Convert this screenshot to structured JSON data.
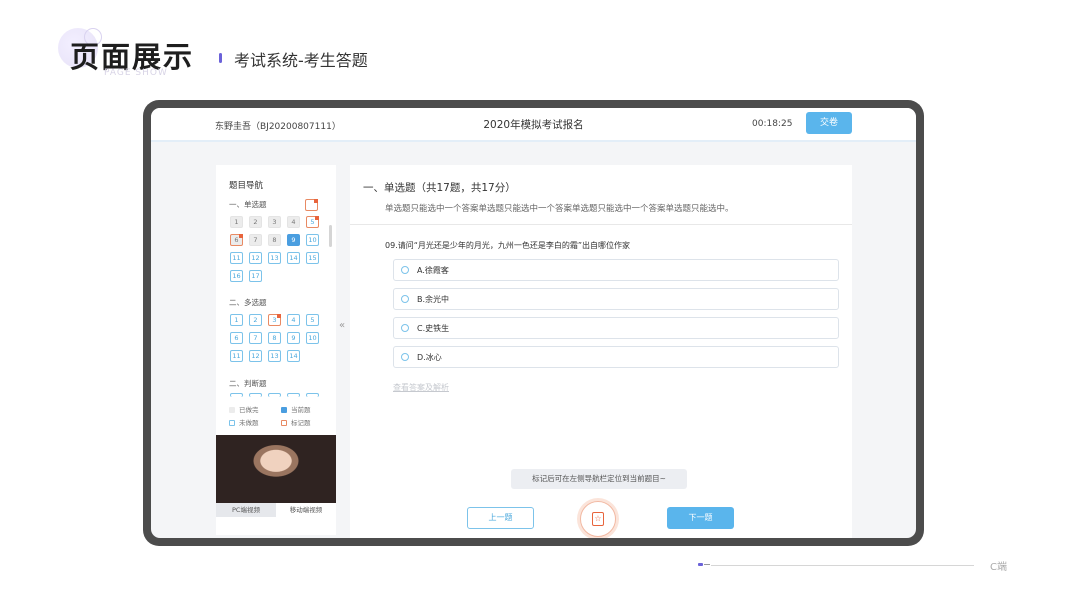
{
  "slide": {
    "title": "页面展示",
    "subtitle_en": "PAGE SHOW",
    "caption": "考试系统-考生答题",
    "footer": "C端",
    "accent_color": "#6b62d9"
  },
  "topbar": {
    "candidate": "东野圭吾（BJ20200807111）",
    "exam_name": "2020年模拟考试报名",
    "timer": "00:18:25",
    "submit_label": "交卷",
    "accent_color": "#5ab5ec"
  },
  "nav": {
    "title": "题目导航",
    "sections": [
      {
        "title": "一、单选题",
        "items": [
          {
            "label": "1",
            "state": "done"
          },
          {
            "label": "2",
            "state": "done"
          },
          {
            "label": "3",
            "state": "done"
          },
          {
            "label": "4",
            "state": "done"
          },
          {
            "label": "5",
            "state": "todo-marked"
          },
          {
            "label": "6",
            "state": "done-marked"
          },
          {
            "label": "7",
            "state": "done"
          },
          {
            "label": "8",
            "state": "done"
          },
          {
            "label": "9",
            "state": "current"
          },
          {
            "label": "10",
            "state": "todo"
          },
          {
            "label": "11",
            "state": "todo"
          },
          {
            "label": "12",
            "state": "todo"
          },
          {
            "label": "13",
            "state": "todo"
          },
          {
            "label": "14",
            "state": "todo"
          },
          {
            "label": "15",
            "state": "todo"
          },
          {
            "label": "16",
            "state": "todo"
          },
          {
            "label": "17",
            "state": "todo"
          }
        ]
      },
      {
        "title": "二、多选题",
        "items": [
          {
            "label": "1",
            "state": "todo"
          },
          {
            "label": "2",
            "state": "todo"
          },
          {
            "label": "3",
            "state": "todo-marked"
          },
          {
            "label": "4",
            "state": "todo"
          },
          {
            "label": "5",
            "state": "todo"
          },
          {
            "label": "6",
            "state": "todo"
          },
          {
            "label": "7",
            "state": "todo"
          },
          {
            "label": "8",
            "state": "todo"
          },
          {
            "label": "9",
            "state": "todo"
          },
          {
            "label": "10",
            "state": "todo"
          },
          {
            "label": "11",
            "state": "todo"
          },
          {
            "label": "12",
            "state": "todo"
          },
          {
            "label": "13",
            "state": "todo"
          },
          {
            "label": "14",
            "state": "todo"
          }
        ]
      },
      {
        "title": "二、判断题",
        "items": []
      }
    ],
    "legend": {
      "done": "已做完",
      "current": "当前题",
      "todo": "未做题",
      "marked": "标记题"
    },
    "video_tabs": [
      "PC端视频",
      "移动端视频"
    ]
  },
  "main": {
    "section_head": "一、单选题（共17题，共17分）",
    "section_desc": "单选题只能选中一个答案单选题只能选中一个答案单选题只能选中一个答案单选题只能选中。",
    "question": "09.请问“月光还是少年的月光，九州一色还是李白的霜”出自哪位作家",
    "options": [
      "A.徐霞客",
      "B.余光中",
      "C.史铁生",
      "D.冰心"
    ],
    "answer_link": "查看答案及解析",
    "tip": "标记后可在左侧导航栏定位到当前题目~",
    "prev_label": "上一题",
    "next_label": "下一题",
    "mark_color": "#e8643c"
  }
}
